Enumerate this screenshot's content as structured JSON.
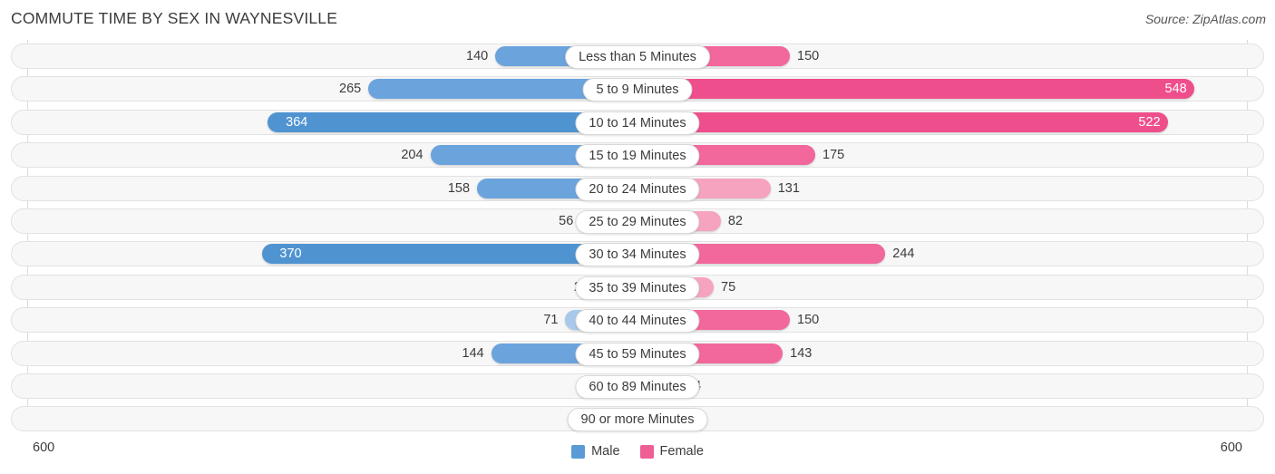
{
  "header": {
    "title": "COMMUTE TIME BY SEX IN WAYNESVILLE",
    "source": "Source: ZipAtlas.com"
  },
  "axis": {
    "left_end_label": "600",
    "right_end_label": "600",
    "max": 600
  },
  "legend": {
    "items": [
      {
        "label": "Male",
        "color": "#5b9bd5"
      },
      {
        "label": "Female",
        "color": "#ef5e94"
      }
    ]
  },
  "colors": {
    "male_strong": "#4f93d1",
    "male_mid": "#6ba3dd",
    "male_light": "#a8c9ea",
    "female_strong": "#ef4e8c",
    "female_mid": "#f2679c",
    "female_light": "#f6a3c0",
    "track_bg": "#f7f7f7",
    "track_border": "#e2e2e2",
    "gridline": "#dcdcdc",
    "text": "#3c3c3c"
  },
  "chart_data": {
    "type": "bar",
    "title": "COMMUTE TIME BY SEX IN WAYNESVILLE",
    "subtitle": "",
    "xlabel": "",
    "ylabel": "",
    "orientation": "horizontal",
    "layout": "diverging-bidirectional",
    "legend_position": "bottom-center",
    "grid": true,
    "xlim": [
      600,
      600
    ],
    "categories": [
      "Less than 5 Minutes",
      "5 to 9 Minutes",
      "10 to 14 Minutes",
      "15 to 19 Minutes",
      "20 to 24 Minutes",
      "25 to 29 Minutes",
      "30 to 34 Minutes",
      "35 to 39 Minutes",
      "40 to 44 Minutes",
      "45 to 59 Minutes",
      "60 to 89 Minutes",
      "90 or more Minutes"
    ],
    "series": [
      {
        "name": "Male",
        "color": "#5b9bd5",
        "side": "left",
        "values": [
          140,
          265,
          364,
          204,
          158,
          56,
          370,
          21,
          71,
          144,
          1,
          0
        ]
      },
      {
        "name": "Female",
        "color": "#ef5e94",
        "side": "right",
        "values": [
          150,
          548,
          522,
          175,
          131,
          82,
          244,
          75,
          150,
          143,
          14,
          0
        ]
      }
    ]
  }
}
